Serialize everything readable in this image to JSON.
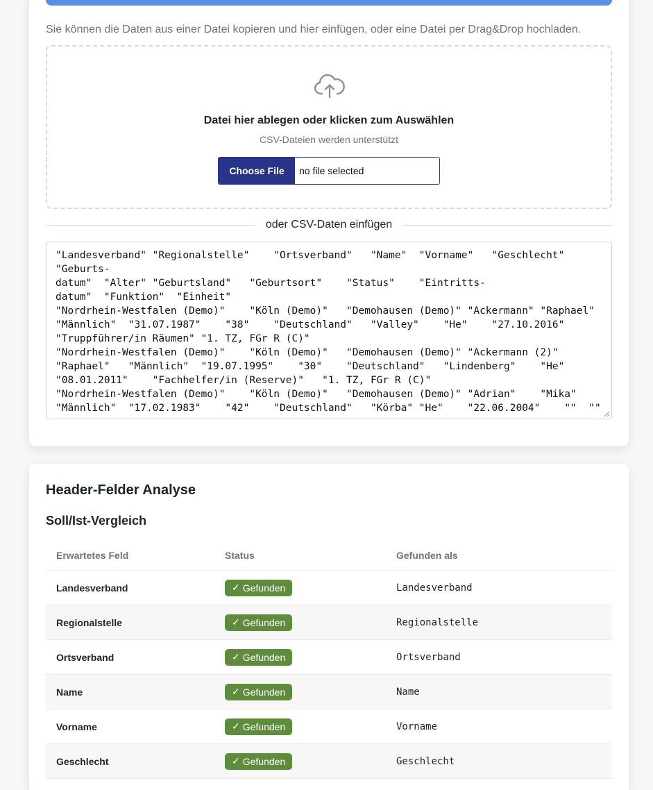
{
  "upload": {
    "help_text": "Sie können die Daten aus einer Datei kopieren und hier einfügen, oder eine Datei per Drag&Drop hochladen.",
    "dropzone_title": "Datei hier ablegen oder klicken zum Auswählen",
    "dropzone_subtitle": "CSV-Dateien werden unterstützt",
    "file_button": "Choose File",
    "file_status": "no file selected",
    "divider_label": "oder CSV-Daten einfügen",
    "csv_content": "\"Landesverband\" \"Regionalstelle\"    \"Ortsverband\"   \"Name\"  \"Vorname\"   \"Geschlecht\"\n\"Geburts-\ndatum\"  \"Alter\" \"Geburtsland\"   \"Geburtsort\"    \"Status\"    \"Eintritts-\ndatum\"  \"Funktion\"  \"Einheit\"\n\"Nordrhein-Westfalen (Demo)\"    \"Köln (Demo)\"   \"Demohausen (Demo)\" \"Ackermann\" \"Raphael\"\n\"Männlich\"  \"31.07.1987\"    \"38\"    \"Deutschland\"   \"Valley\"    \"He\"    \"27.10.2016\"\n\"Truppführer/in Räumen\" \"1. TZ, FGr R (C)\"\n\"Nordrhein-Westfalen (Demo)\"    \"Köln (Demo)\"   \"Demohausen (Demo)\" \"Ackermann (2)\"\n\"Raphael\"   \"Männlich\"  \"19.07.1995\"    \"30\"    \"Deutschland\"   \"Lindenberg\"    \"He\"\n\"08.01.2011\"    \"Fachhelfer/in (Reserve)\"   \"1. TZ, FGr R (C)\"\n\"Nordrhein-Westfalen (Demo)\"    \"Köln (Demo)\"   \"Demohausen (Demo)\" \"Adrian\"    \"Mika\"\n\"Männlich\"  \"17.02.1983\"    \"42\"    \"Deutschland\"   \"Körba\" \"He\"    \"22.06.2004\"    \"\"  \"\""
  },
  "analysis": {
    "title": "Header-Felder Analyse",
    "subtitle": "Soll/Ist-Vergleich",
    "columns": [
      "Erwartetes Feld",
      "Status",
      "Gefunden als"
    ],
    "rows": [
      {
        "expected": "Landesverband",
        "status": "Gefunden",
        "found": "Landesverband"
      },
      {
        "expected": "Regionalstelle",
        "status": "Gefunden",
        "found": "Regionalstelle"
      },
      {
        "expected": "Ortsverband",
        "status": "Gefunden",
        "found": "Ortsverband"
      },
      {
        "expected": "Name",
        "status": "Gefunden",
        "found": "Name"
      },
      {
        "expected": "Vorname",
        "status": "Gefunden",
        "found": "Vorname"
      },
      {
        "expected": "Geschlecht",
        "status": "Gefunden",
        "found": "Geschlecht"
      }
    ],
    "status_check_glyph": "✓"
  },
  "colors": {
    "accent_blue": "#5b8fe0",
    "button_navy": "#28338a",
    "success_green": "#5e8c3c"
  },
  "icons": {
    "upload": "cloud-upload-icon",
    "check": "check-icon"
  }
}
